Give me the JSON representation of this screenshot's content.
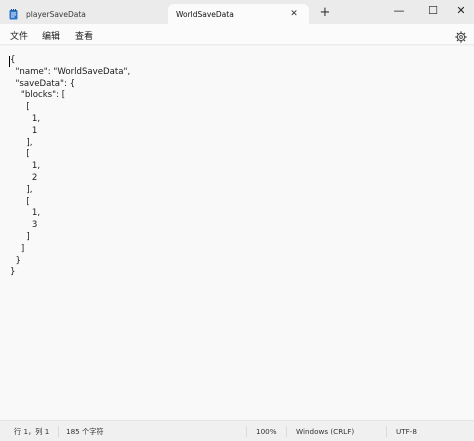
{
  "tabs": [
    {
      "label": "playerSaveData",
      "active": false
    },
    {
      "label": "WorldSaveData",
      "active": true
    }
  ],
  "tab_close_glyph": "✕",
  "new_tab_glyph": "+",
  "window_controls": {
    "minimize": "—",
    "maximize": "☐",
    "close": "✕"
  },
  "menu": {
    "file": "文件",
    "edit": "编辑",
    "view": "查看"
  },
  "editor": {
    "content": "{\n  \"name\": \"WorldSaveData\",\n  \"saveData\": {\n    \"blocks\": [\n      [\n        1,\n        1\n      ],\n      [\n        1,\n        2\n      ],\n      [\n        1,\n        3\n      ]\n    ]\n  }\n}"
  },
  "status": {
    "position": "行 1，列 1",
    "char_count": "185 个字符",
    "zoom": "100%",
    "line_ending": "Windows (CRLF)",
    "encoding": "UTF-8"
  },
  "icons": {
    "file_icon": "notepad-icon",
    "settings": "gear-icon"
  },
  "colors": {
    "titlebar": "#ebebeb",
    "active_tab": "#fbfbfb",
    "editor_bg": "#f9f9f9",
    "notepad_icon": "#2b73c9"
  }
}
